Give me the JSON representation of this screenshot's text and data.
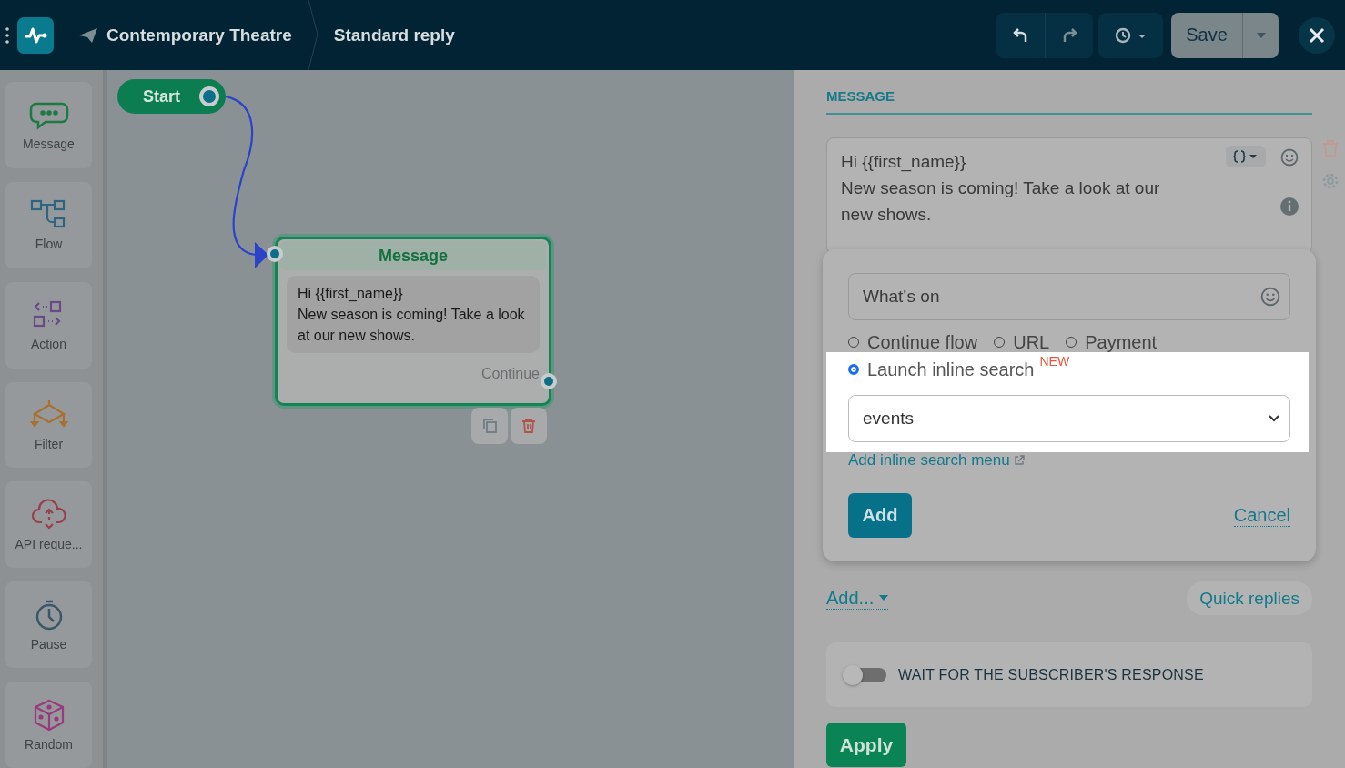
{
  "header": {
    "workspace": "Contemporary Theatre",
    "title": "Standard reply",
    "save_label": "Save"
  },
  "sidebar": {
    "items": [
      {
        "label": "Message",
        "kind": "message"
      },
      {
        "label": "Flow",
        "kind": "flow"
      },
      {
        "label": "Action",
        "kind": "action"
      },
      {
        "label": "Filter",
        "kind": "filter"
      },
      {
        "label": "API reque...",
        "kind": "api"
      },
      {
        "label": "Pause",
        "kind": "pause"
      },
      {
        "label": "Random",
        "kind": "random"
      }
    ]
  },
  "canvas": {
    "start": {
      "label": "Start"
    },
    "node": {
      "title": "Message",
      "text": "Hi {{first_name}}\nNew season is coming! Take a look at our new shows.",
      "output": "Continue"
    }
  },
  "panel": {
    "section": "MESSAGE",
    "message_text": "Hi {{first_name}}\nNew season is coming! Take a look at our new shows.",
    "button_editor": {
      "title_value": "What‛s on",
      "options": [
        {
          "label": "Continue flow",
          "selected": false
        },
        {
          "label": "URL",
          "selected": false
        },
        {
          "label": "Payment",
          "selected": false
        },
        {
          "label": "Launch inline search",
          "selected": true,
          "badge": "NEW"
        }
      ],
      "select_value": "events",
      "link": "Add inline search menu",
      "add": "Add",
      "cancel": "Cancel"
    },
    "add_menu": "Add...",
    "quick_replies": "Quick replies",
    "wait_toggle": {
      "label": "WAIT FOR THE SUBSCRIBER'S RESPONSE",
      "on": false
    },
    "apply": "Apply"
  }
}
